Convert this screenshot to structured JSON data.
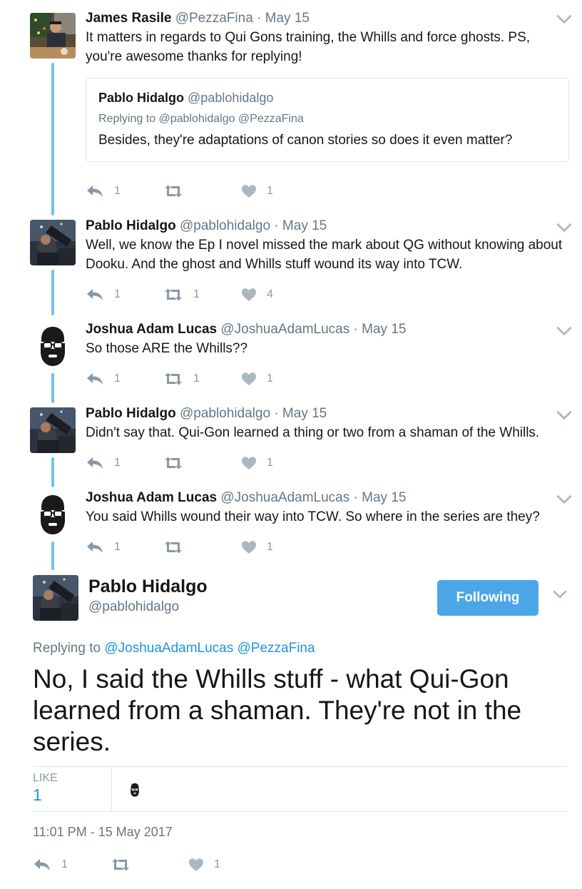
{
  "colors": {
    "accent": "#1b95e0",
    "thread": "#6ec1f0",
    "follow_bg": "#4ba6e8",
    "muted": "#657786"
  },
  "thread": [
    {
      "name": "James Rasile",
      "handle": "@PezzaFina",
      "sep": "·",
      "date": "May 15",
      "text": "It matters in regards to Qui Gons training, the Whills and force ghosts. PS, you're awesome thanks for replying!",
      "quoted": {
        "name": "Pablo Hidalgo",
        "handle": "@pablohidalgo",
        "replying": "Replying to @pablohidalgo @PezzaFina",
        "text": "Besides, they're adaptations of canon stories so does it even matter?"
      },
      "replies": "1",
      "retweets": "",
      "likes": "1"
    },
    {
      "name": "Pablo Hidalgo",
      "handle": "@pablohidalgo",
      "sep": "·",
      "date": "May 15",
      "text": "Well, we know the Ep I novel missed the mark about QG without knowing about Dooku. And the ghost and Whills stuff wound its way into TCW.",
      "replies": "1",
      "retweets": "1",
      "likes": "4"
    },
    {
      "name": "Joshua Adam Lucas",
      "handle": "@JoshuaAdamLucas",
      "sep": "·",
      "date": "May 15",
      "text": "So those ARE the Whills??",
      "replies": "1",
      "retweets": "1",
      "likes": "1"
    },
    {
      "name": "Pablo Hidalgo",
      "handle": "@pablohidalgo",
      "sep": "·",
      "date": "May 15",
      "text": "Didn't say that. Qui-Gon learned a thing or two from a shaman of the Whills.",
      "replies": "1",
      "retweets": "",
      "likes": "1"
    },
    {
      "name": "Joshua Adam Lucas",
      "handle": "@JoshuaAdamLucas",
      "sep": "·",
      "date": "May 15",
      "text": "You said Whills wound their way into TCW. So where in the series are they?",
      "replies": "1",
      "retweets": "",
      "likes": "1"
    }
  ],
  "main": {
    "name": "Pablo Hidalgo",
    "handle": "@pablohidalgo",
    "follow_label": "Following",
    "replying_prefix": "Replying to",
    "replying_to_1": "@JoshuaAdamLucas",
    "replying_to_2": "@PezzaFina",
    "text": "No, I said the Whills stuff - what Qui-Gon learned from a shaman. They're not in the series.",
    "like_label": "LIKE",
    "like_count": "1",
    "timestamp": "11:01 PM - 15 May 2017",
    "replies": "1",
    "retweets": "",
    "likes": "1"
  },
  "icons": {
    "reply": "reply-icon",
    "retweet": "retweet-icon",
    "like": "heart-icon",
    "more": "chevron-down-icon"
  }
}
